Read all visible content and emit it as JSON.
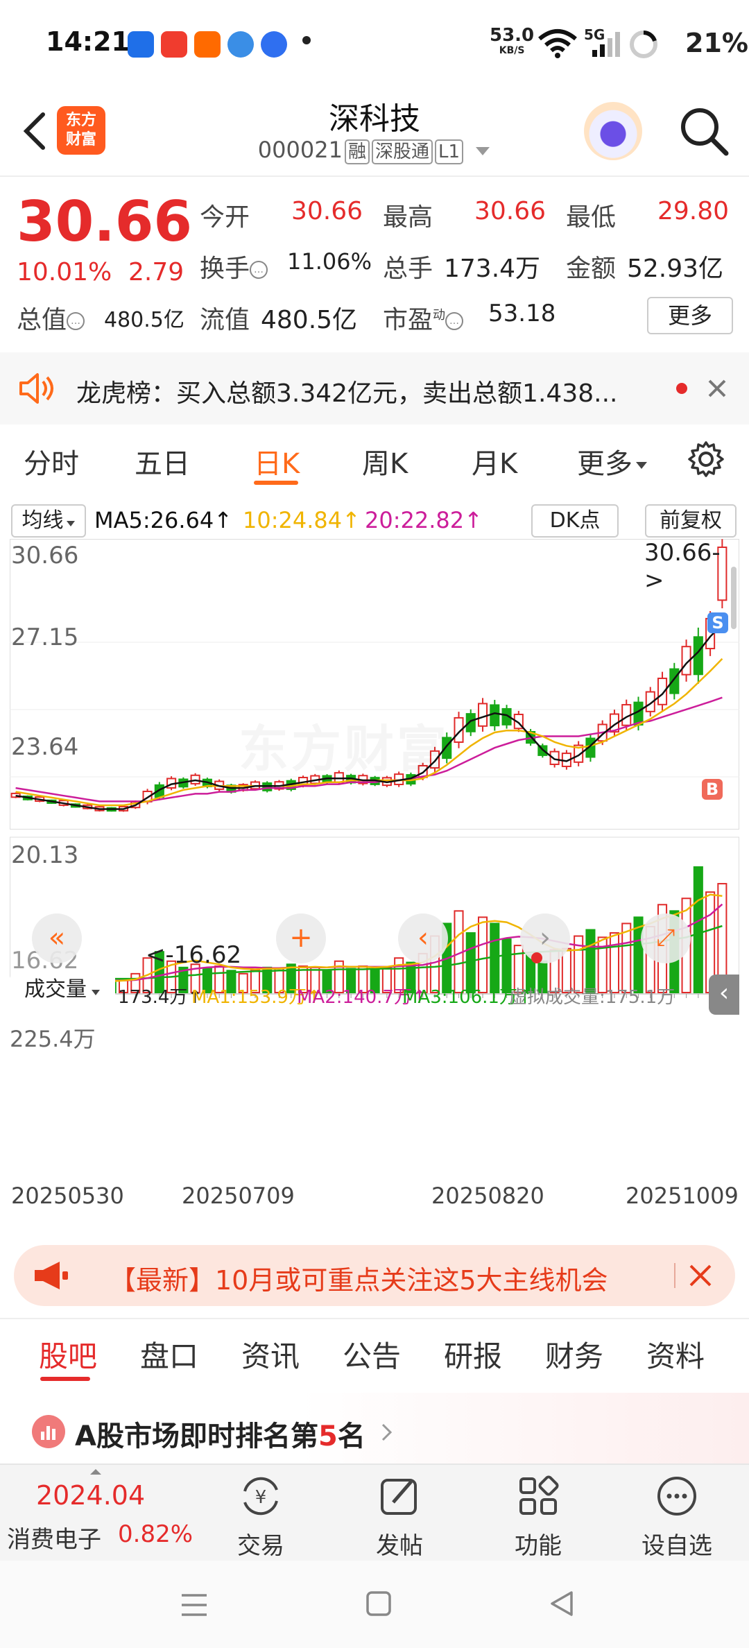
{
  "status": {
    "time": "14:21",
    "net_speed": "53.0",
    "net_unit": "KB/S",
    "signal": "5G",
    "battery": "21%"
  },
  "header": {
    "title": "深科技",
    "code": "000021",
    "tags": [
      "融",
      "深股通",
      "L1"
    ],
    "logo_line1": "东方",
    "logo_line2": "财富"
  },
  "quote": {
    "price": "30.66",
    "change_pct": "10.01%",
    "change": "2.79",
    "fields": [
      {
        "label": "今开",
        "value": "30.66"
      },
      {
        "label": "最高",
        "value": "30.66"
      },
      {
        "label": "最低",
        "value": "29.80"
      },
      {
        "label": "换手",
        "value": "11.06%"
      },
      {
        "label": "总手",
        "value": "173.4万"
      },
      {
        "label": "金额",
        "value": "52.93亿"
      },
      {
        "label": "总值",
        "value": "480.5亿"
      },
      {
        "label": "流值",
        "value": "480.5亿"
      },
      {
        "label": "市盈",
        "sup": "动",
        "value": "53.18"
      }
    ],
    "more": "更多"
  },
  "dragon": {
    "text": "龙虎榜：买入总额3.342亿元，卖出总额1.438..."
  },
  "chart_tabs": {
    "items": [
      "分时",
      "五日",
      "日K",
      "周K",
      "月K",
      "更多"
    ],
    "active": "日K"
  },
  "chart_legend": {
    "ma_selector": "均线",
    "ma5": "MA5:26.64↑",
    "ma10": "10:24.84↑",
    "ma20": "20:22.82↑",
    "dk": "DK点",
    "adj": "前复权"
  },
  "volume_legend": {
    "selector": "成交量",
    "vol": "173.4万↑",
    "ma1": "MA1:153.9万↑",
    "ma2": "MA2:140.7万↑",
    "ma3": "MA3:106.1万↑",
    "virtual": "虚拟成交量:175.1万"
  },
  "chart_marks": {
    "last_price_tag": "30.66->",
    "low_tag": "<-16.62",
    "s_marker": "S",
    "b_marker": "B",
    "watermark": "东方财富"
  },
  "chart_data": [
    {
      "type": "candlestick",
      "y_ticks": [
        "30.66",
        "27.15",
        "23.64",
        "20.13",
        "16.62"
      ],
      "ylim": [
        16.62,
        30.66
      ],
      "x_ticks": [
        "20250530",
        "20250709",
        "20250820",
        "20251009"
      ],
      "colors": {
        "up": "#e02a2a",
        "down": "#16a816",
        "ma5": "#111111",
        "ma10": "#f0b400",
        "ma20": "#cc1d9a"
      },
      "ma5": [
        17.7,
        17.6,
        17.5,
        17.4,
        17.3,
        17.2,
        17.1,
        17.0,
        17.0,
        17.0,
        17.2,
        17.6,
        18.0,
        18.3,
        18.4,
        18.5,
        18.4,
        18.2,
        18.1,
        18.1,
        18.2,
        18.2,
        18.2,
        18.3,
        18.4,
        18.5,
        18.6,
        18.6,
        18.6,
        18.5,
        18.5,
        18.4,
        18.5,
        18.6,
        18.9,
        19.5,
        20.3,
        21.0,
        21.6,
        21.8,
        22.0,
        21.9,
        21.5,
        20.8,
        20.1,
        19.6,
        19.5,
        19.8,
        20.3,
        20.9,
        21.4,
        21.8,
        22.1,
        22.5,
        23.0,
        23.8,
        24.6,
        25.2,
        26.0,
        26.64
      ],
      "ma10": [
        17.9,
        17.8,
        17.7,
        17.6,
        17.5,
        17.4,
        17.3,
        17.2,
        17.2,
        17.2,
        17.3,
        17.4,
        17.6,
        17.8,
        18.0,
        18.1,
        18.2,
        18.2,
        18.2,
        18.2,
        18.2,
        18.2,
        18.2,
        18.2,
        18.3,
        18.3,
        18.4,
        18.4,
        18.5,
        18.5,
        18.5,
        18.5,
        18.5,
        18.5,
        18.6,
        18.9,
        19.3,
        19.8,
        20.3,
        20.7,
        21.0,
        21.1,
        21.1,
        21.0,
        20.8,
        20.5,
        20.3,
        20.2,
        20.3,
        20.5,
        20.8,
        21.1,
        21.4,
        21.7,
        22.1,
        22.5,
        23.0,
        23.6,
        24.2,
        24.84
      ],
      "ma20": [
        18.1,
        18.0,
        17.9,
        17.8,
        17.7,
        17.6,
        17.5,
        17.4,
        17.4,
        17.4,
        17.4,
        17.4,
        17.5,
        17.6,
        17.7,
        17.8,
        17.8,
        17.9,
        17.9,
        18.0,
        18.0,
        18.1,
        18.1,
        18.1,
        18.2,
        18.2,
        18.3,
        18.3,
        18.4,
        18.4,
        18.4,
        18.5,
        18.5,
        18.6,
        18.7,
        18.8,
        19.0,
        19.3,
        19.6,
        19.9,
        20.2,
        20.4,
        20.6,
        20.7,
        20.8,
        20.8,
        20.8,
        20.8,
        20.9,
        21.0,
        21.1,
        21.3,
        21.5,
        21.6,
        21.8,
        22.0,
        22.2,
        22.4,
        22.6,
        22.82
      ]
    },
    {
      "type": "bar",
      "title": "成交量",
      "y_ticks": [
        "225.4万"
      ],
      "ylim": [
        0,
        225.4
      ],
      "values": [
        20,
        18,
        22,
        15,
        25,
        12,
        18,
        20,
        16,
        22,
        30,
        55,
        65,
        50,
        40,
        45,
        38,
        42,
        35,
        30,
        36,
        40,
        38,
        45,
        42,
        40,
        35,
        50,
        38,
        42,
        36,
        40,
        55,
        48,
        62,
        90,
        110,
        130,
        95,
        120,
        110,
        85,
        75,
        60,
        50,
        68,
        70,
        90,
        100,
        88,
        95,
        110,
        120,
        105,
        140,
        130,
        150,
        200,
        160,
        173.4
      ],
      "up": [
        1,
        0,
        1,
        0,
        1,
        0,
        1,
        1,
        0,
        1,
        1,
        1,
        0,
        1,
        0,
        1,
        0,
        1,
        0,
        1,
        1,
        0,
        1,
        0,
        1,
        1,
        0,
        1,
        0,
        1,
        0,
        1,
        1,
        0,
        1,
        1,
        0,
        1,
        0,
        1,
        0,
        0,
        1,
        0,
        0,
        1,
        1,
        1,
        0,
        1,
        1,
        1,
        0,
        1,
        1,
        0,
        1,
        0,
        1,
        1
      ],
      "ma1": [
        20,
        20,
        19,
        19,
        20,
        19,
        18,
        19,
        18,
        19,
        21,
        28,
        37,
        44,
        48,
        51,
        48,
        45,
        40,
        38,
        37,
        38,
        38,
        40,
        40,
        41,
        40,
        42,
        41,
        41,
        40,
        41,
        44,
        45,
        48,
        58,
        73,
        92,
        105,
        112,
        114,
        112,
        104,
        92,
        79,
        70,
        67,
        68,
        75,
        84,
        91,
        97,
        104,
        110,
        118,
        124,
        131,
        147,
        156,
        153.9
      ],
      "ma2": [
        22,
        21,
        21,
        20,
        20,
        20,
        19,
        19,
        19,
        19,
        20,
        23,
        27,
        31,
        35,
        38,
        40,
        41,
        41,
        40,
        40,
        39,
        39,
        40,
        40,
        40,
        40,
        41,
        41,
        41,
        41,
        41,
        42,
        43,
        44,
        48,
        54,
        62,
        70,
        77,
        83,
        87,
        89,
        88,
        86,
        82,
        78,
        75,
        73,
        73,
        76,
        79,
        83,
        87,
        92,
        98,
        104,
        114,
        124,
        140.7
      ],
      "ma3": [
        25,
        24,
        24,
        23,
        23,
        23,
        22,
        22,
        22,
        22,
        22,
        23,
        24,
        25,
        27,
        28,
        30,
        31,
        32,
        33,
        34,
        34,
        35,
        35,
        36,
        36,
        36,
        37,
        37,
        37,
        38,
        38,
        38,
        39,
        40,
        41,
        43,
        46,
        50,
        54,
        57,
        60,
        62,
        64,
        65,
        66,
        67,
        68,
        69,
        71,
        73,
        75,
        77,
        79,
        82,
        85,
        88,
        94,
        100,
        106.1
      ]
    }
  ],
  "ad": {
    "text": "【最新】10月或可重点关注这5大主线机会"
  },
  "bottom_tabs": {
    "items": [
      "股吧",
      "盘口",
      "资讯",
      "公告",
      "研报",
      "财务",
      "资料"
    ],
    "active": "股吧"
  },
  "rank": {
    "prefix": "A股市场即时排名第",
    "num": "5",
    "suffix": "名"
  },
  "toolbar": {
    "index_value": "2024.04",
    "index_name": "消费电子",
    "index_pct": "0.82%",
    "items": [
      "交易",
      "发帖",
      "功能",
      "设自选"
    ]
  }
}
